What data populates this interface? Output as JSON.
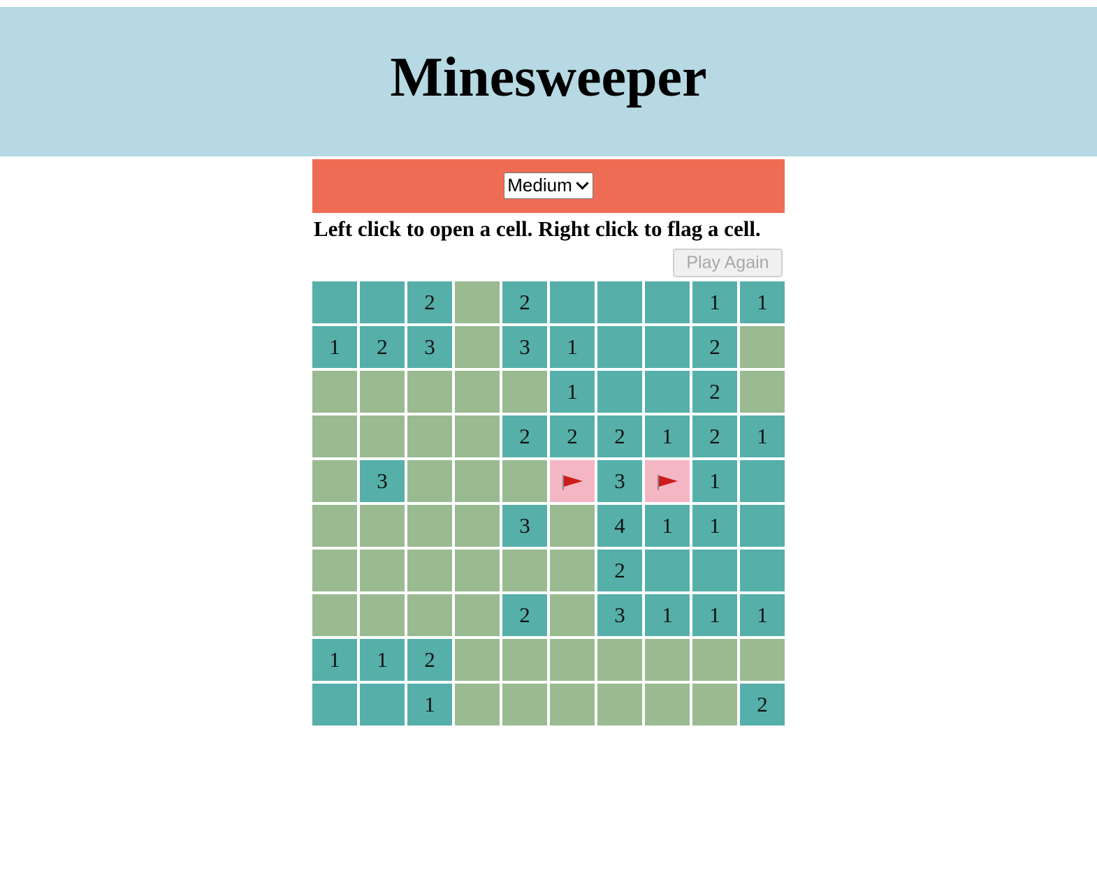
{
  "header": {
    "title": "Minesweeper"
  },
  "controls": {
    "difficulty_selected": "Medium",
    "instructions": "Left click to open a cell. Right click to flag a cell.",
    "play_again_label": "Play Again"
  },
  "colors": {
    "header_bg": "#b6d9e3",
    "controls_bg": "#ef6c54",
    "open_cell": "#56afa9",
    "closed_cell": "#9aba92",
    "flagged_cell": "#f5b6c4",
    "flag": "#cc1c1c"
  },
  "board": {
    "rows": [
      [
        {
          "s": "open",
          "v": ""
        },
        {
          "s": "open",
          "v": ""
        },
        {
          "s": "open",
          "v": "2"
        },
        {
          "s": "closed",
          "v": ""
        },
        {
          "s": "open",
          "v": "2"
        },
        {
          "s": "open",
          "v": ""
        },
        {
          "s": "open",
          "v": ""
        },
        {
          "s": "open",
          "v": ""
        },
        {
          "s": "open",
          "v": "1"
        },
        {
          "s": "open",
          "v": "1"
        }
      ],
      [
        {
          "s": "open",
          "v": "1"
        },
        {
          "s": "open",
          "v": "2"
        },
        {
          "s": "open",
          "v": "3"
        },
        {
          "s": "closed",
          "v": ""
        },
        {
          "s": "open",
          "v": "3"
        },
        {
          "s": "open",
          "v": "1"
        },
        {
          "s": "open",
          "v": ""
        },
        {
          "s": "open",
          "v": ""
        },
        {
          "s": "open",
          "v": "2"
        },
        {
          "s": "closed",
          "v": ""
        }
      ],
      [
        {
          "s": "closed",
          "v": ""
        },
        {
          "s": "closed",
          "v": ""
        },
        {
          "s": "closed",
          "v": ""
        },
        {
          "s": "closed",
          "v": ""
        },
        {
          "s": "closed",
          "v": ""
        },
        {
          "s": "open",
          "v": "1"
        },
        {
          "s": "open",
          "v": ""
        },
        {
          "s": "open",
          "v": ""
        },
        {
          "s": "open",
          "v": "2"
        },
        {
          "s": "closed",
          "v": ""
        }
      ],
      [
        {
          "s": "closed",
          "v": ""
        },
        {
          "s": "closed",
          "v": ""
        },
        {
          "s": "closed",
          "v": ""
        },
        {
          "s": "closed",
          "v": ""
        },
        {
          "s": "open",
          "v": "2"
        },
        {
          "s": "open",
          "v": "2"
        },
        {
          "s": "open",
          "v": "2"
        },
        {
          "s": "open",
          "v": "1"
        },
        {
          "s": "open",
          "v": "2"
        },
        {
          "s": "open",
          "v": "1"
        }
      ],
      [
        {
          "s": "closed",
          "v": ""
        },
        {
          "s": "open",
          "v": "3"
        },
        {
          "s": "closed",
          "v": ""
        },
        {
          "s": "closed",
          "v": ""
        },
        {
          "s": "closed",
          "v": ""
        },
        {
          "s": "flagged",
          "v": ""
        },
        {
          "s": "open",
          "v": "3"
        },
        {
          "s": "flagged",
          "v": ""
        },
        {
          "s": "open",
          "v": "1"
        },
        {
          "s": "open",
          "v": ""
        }
      ],
      [
        {
          "s": "closed",
          "v": ""
        },
        {
          "s": "closed",
          "v": ""
        },
        {
          "s": "closed",
          "v": ""
        },
        {
          "s": "closed",
          "v": ""
        },
        {
          "s": "open",
          "v": "3"
        },
        {
          "s": "closed",
          "v": ""
        },
        {
          "s": "open",
          "v": "4"
        },
        {
          "s": "open",
          "v": "1"
        },
        {
          "s": "open",
          "v": "1"
        },
        {
          "s": "open",
          "v": ""
        }
      ],
      [
        {
          "s": "closed",
          "v": ""
        },
        {
          "s": "closed",
          "v": ""
        },
        {
          "s": "closed",
          "v": ""
        },
        {
          "s": "closed",
          "v": ""
        },
        {
          "s": "closed",
          "v": ""
        },
        {
          "s": "closed",
          "v": ""
        },
        {
          "s": "open",
          "v": "2"
        },
        {
          "s": "open",
          "v": ""
        },
        {
          "s": "open",
          "v": ""
        },
        {
          "s": "open",
          "v": ""
        }
      ],
      [
        {
          "s": "closed",
          "v": ""
        },
        {
          "s": "closed",
          "v": ""
        },
        {
          "s": "closed",
          "v": ""
        },
        {
          "s": "closed",
          "v": ""
        },
        {
          "s": "open",
          "v": "2"
        },
        {
          "s": "closed",
          "v": ""
        },
        {
          "s": "open",
          "v": "3"
        },
        {
          "s": "open",
          "v": "1"
        },
        {
          "s": "open",
          "v": "1"
        },
        {
          "s": "open",
          "v": "1"
        }
      ],
      [
        {
          "s": "open",
          "v": "1"
        },
        {
          "s": "open",
          "v": "1"
        },
        {
          "s": "open",
          "v": "2"
        },
        {
          "s": "closed",
          "v": ""
        },
        {
          "s": "closed",
          "v": ""
        },
        {
          "s": "closed",
          "v": ""
        },
        {
          "s": "closed",
          "v": ""
        },
        {
          "s": "closed",
          "v": ""
        },
        {
          "s": "closed",
          "v": ""
        },
        {
          "s": "closed",
          "v": ""
        }
      ],
      [
        {
          "s": "open",
          "v": ""
        },
        {
          "s": "open",
          "v": ""
        },
        {
          "s": "open",
          "v": "1"
        },
        {
          "s": "closed",
          "v": ""
        },
        {
          "s": "closed",
          "v": ""
        },
        {
          "s": "closed",
          "v": ""
        },
        {
          "s": "closed",
          "v": ""
        },
        {
          "s": "closed",
          "v": ""
        },
        {
          "s": "closed",
          "v": ""
        },
        {
          "s": "open",
          "v": "2"
        }
      ]
    ]
  }
}
